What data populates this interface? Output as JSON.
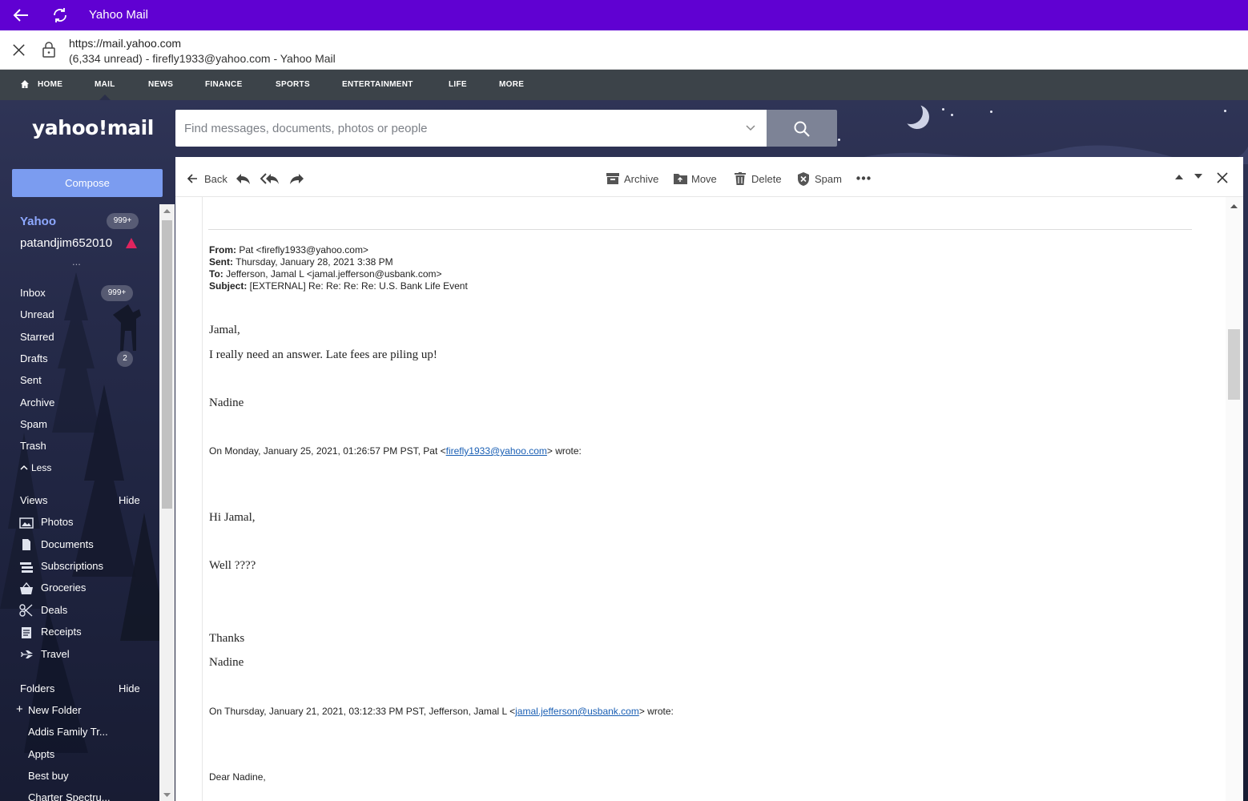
{
  "window": {
    "title": "Yahoo Mail",
    "url": "https://mail.yahoo.com",
    "page_title": "(6,334 unread) - firefly1933@yahoo.com - Yahoo Mail"
  },
  "nav": {
    "items": [
      "HOME",
      "MAIL",
      "NEWS",
      "FINANCE",
      "SPORTS",
      "ENTERTAINMENT",
      "LIFE",
      "MORE"
    ]
  },
  "brand": {
    "logo": "yahoo!mail"
  },
  "search": {
    "placeholder": "Find messages, documents, photos or people"
  },
  "sidebar": {
    "compose": "Compose",
    "accounts": [
      {
        "name": "Yahoo",
        "badge": "999+"
      },
      {
        "name": "patandjim652010"
      }
    ],
    "more_dots": "...",
    "folders_main": [
      {
        "label": "Inbox",
        "badge": "999+"
      },
      {
        "label": "Unread"
      },
      {
        "label": "Starred"
      },
      {
        "label": "Drafts",
        "badge": "2"
      },
      {
        "label": "Sent"
      },
      {
        "label": "Archive"
      },
      {
        "label": "Spam"
      },
      {
        "label": "Trash"
      }
    ],
    "less": "Less",
    "views_title": "Views",
    "views_hide": "Hide",
    "views": [
      {
        "label": "Photos",
        "icon": "photo-icon"
      },
      {
        "label": "Documents",
        "icon": "document-icon"
      },
      {
        "label": "Subscriptions",
        "icon": "subscriptions-icon"
      },
      {
        "label": "Groceries",
        "icon": "basket-icon"
      },
      {
        "label": "Deals",
        "icon": "scissors-icon"
      },
      {
        "label": "Receipts",
        "icon": "receipt-icon"
      },
      {
        "label": "Travel",
        "icon": "plane-icon"
      }
    ],
    "folders_title": "Folders",
    "folders_hide": "Hide",
    "new_folder": "New Folder",
    "user_folders": [
      "Addis Family Tr...",
      "Appts",
      "Best buy",
      "Charter Spectru..."
    ]
  },
  "toolbar": {
    "back": "Back",
    "archive": "Archive",
    "move": "Move",
    "delete": "Delete",
    "spam": "Spam"
  },
  "message": {
    "from_label": "From:",
    "from_value": " Pat <firefly1933@yahoo.com>",
    "sent_label": "Sent:",
    "sent_value": " Thursday, January 28, 2021 3:38 PM",
    "to_label": "To:",
    "to_value": " Jefferson, Jamal L <jamal.jefferson@usbank.com>",
    "subject_label": "Subject:",
    "subject_value": " [EXTERNAL] Re: Re: Re: Re: U.S. Bank Life Event",
    "greeting1": "Jamal,",
    "line1": "I really need an answer.  Late fees are piling up!",
    "sign1": "Nadine",
    "quote1_prefix": "On Monday, January 25, 2021, 01:26:57 PM PST, Pat <",
    "quote1_email": "firefly1933@yahoo.com",
    "quote1_suffix": "> wrote:",
    "greeting2": "Hi Jamal,",
    "line2": "Well ????",
    "thanks": "Thanks",
    "sign2": "Nadine",
    "quote2_prefix": "On Thursday, January 21, 2021, 03:12:33 PM PST, Jefferson, Jamal L <",
    "quote2_email": "jamal.jefferson@usbank.com",
    "quote2_suffix": "> wrote:",
    "greeting3": "Dear Nadine,"
  },
  "colors": {
    "titlebar": "#6001d2",
    "nav": "#3c4349",
    "compose": "#7b9cf0",
    "link": "#1a5fb4"
  }
}
